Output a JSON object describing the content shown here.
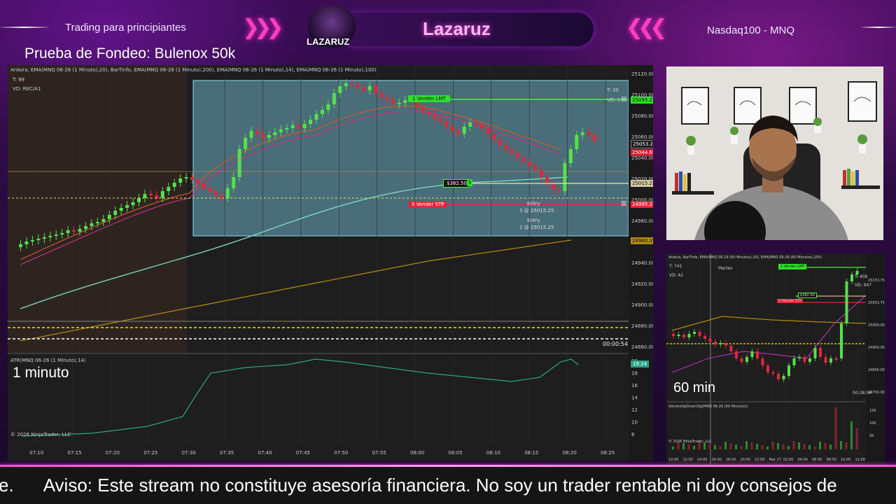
{
  "header": {
    "left_text": "Trading para principiantes",
    "right_text": "Nasdaq100 - MNQ",
    "streamer_name": "Lazaruz",
    "logo_text": "LAZARUZ",
    "stream_title": "Prueba de Fondeo: Bulenox 50k"
  },
  "main_chart": {
    "header": "Ankora, EMA(MNQ 06-26 (1 Minuto),20), BarTinfo, EMA(MNQ 06-26 (1 Minuto),200), EMA(MNQ 06-26 (1 Minuto),14), EMA(MNQ 06-26 (1 Minuto),100)",
    "tick_counter": "T: 99",
    "vd_label": "VD: REC/A1",
    "box_tick": "T: 35",
    "box_vd": "VD: 1",
    "timeframe_label": "1 minuto",
    "timer": "00:00:54",
    "copyright": "© 2026 NinjaTrader, LLC",
    "atr_header": "ATR(MNQ 06-26 (1 Minuto),14)",
    "atr_value": "19.24",
    "order_target": "1 Vender LMT",
    "order_target_price": "25095.25",
    "order_stop": "5 Vender STP",
    "order_stop_price": "24995.25",
    "pnl_label": "$382.50",
    "pnl_qty": "5",
    "entry_price_tag": "25015.25",
    "entry1_title": "Entry",
    "entry1_detail": "3 @ 25015.25",
    "entry2_title": "Entry",
    "entry2_detail": "2 @ 25015.25",
    "price_tags": [
      {
        "label": "25053.25",
        "color": "#1a1a1a"
      },
      {
        "label": "25044.69",
        "color": "#d02030"
      },
      {
        "label": "24960.37",
        "color": "#b08a10"
      }
    ],
    "y_labels": [
      "25120.00",
      "25100.00",
      "25080.00",
      "25060.00",
      "25040.00",
      "25020.00",
      "25000.00",
      "24980.00",
      "24960.00",
      "24940.00",
      "24920.00",
      "24900.00",
      "24880.00",
      "24860.00"
    ],
    "atr_labels": [
      "20",
      "18",
      "16",
      "14",
      "12",
      "10",
      "8"
    ],
    "x_labels": [
      "07:10",
      "07:15",
      "07:20",
      "07:25",
      "07:30",
      "07:35",
      "07:40",
      "07:45",
      "07:50",
      "07:55",
      "08:00",
      "08:05",
      "08:10",
      "08:15",
      "08:20",
      "08:25"
    ]
  },
  "small_chart": {
    "header": "Ankora, BarTinfo, EMA(MNQ 06-26 (60 Minutos),20), EMA(MNQ 06-26 (60 Minutos),200)",
    "tick_counter": "T: 741",
    "vd_label": "VD: A1",
    "day_label": "Martes",
    "box_tick": "T: 408",
    "box_vd": "VD: 997",
    "timeframe_label": "60 min",
    "order_target": "1 Vender LMT",
    "order_stop": "5 Vender STP",
    "pnl_label": "$382.50",
    "timer": "00:38:54",
    "volume_header": "VolumeUpDownObj(MNQ 06-26 (60 Minutos))",
    "copyright": "© 2026 NinjaTrader, LLC",
    "y_labels": [
      "25153.75",
      "25053.75",
      "25000.00",
      "24900.00",
      "24800.00",
      "24750.00"
    ],
    "x_labels": [
      "10:00",
      "12:00",
      "14:00",
      "16:00",
      "18:00",
      "20:00",
      "22:00",
      "Mar 17",
      "02:00",
      "04:00",
      "06:00",
      "08:00",
      "10:00",
      "12:00"
    ],
    "price_tags": [
      "25095.25",
      "25053.75",
      "24995.25",
      "24945.00",
      "24850.25"
    ],
    "vol_labels": [
      "15K",
      "10K",
      "5K"
    ]
  },
  "ticker": {
    "prefix": "e.",
    "message": "Aviso: Este stream no constituye asesoría financiera. No soy un trader rentable ni doy consejos de"
  },
  "colors": {
    "bull": "#55e04a",
    "bear": "#e0283c",
    "accent_pink": "#ff3fbf",
    "selection_box": "#7fd0e8"
  }
}
